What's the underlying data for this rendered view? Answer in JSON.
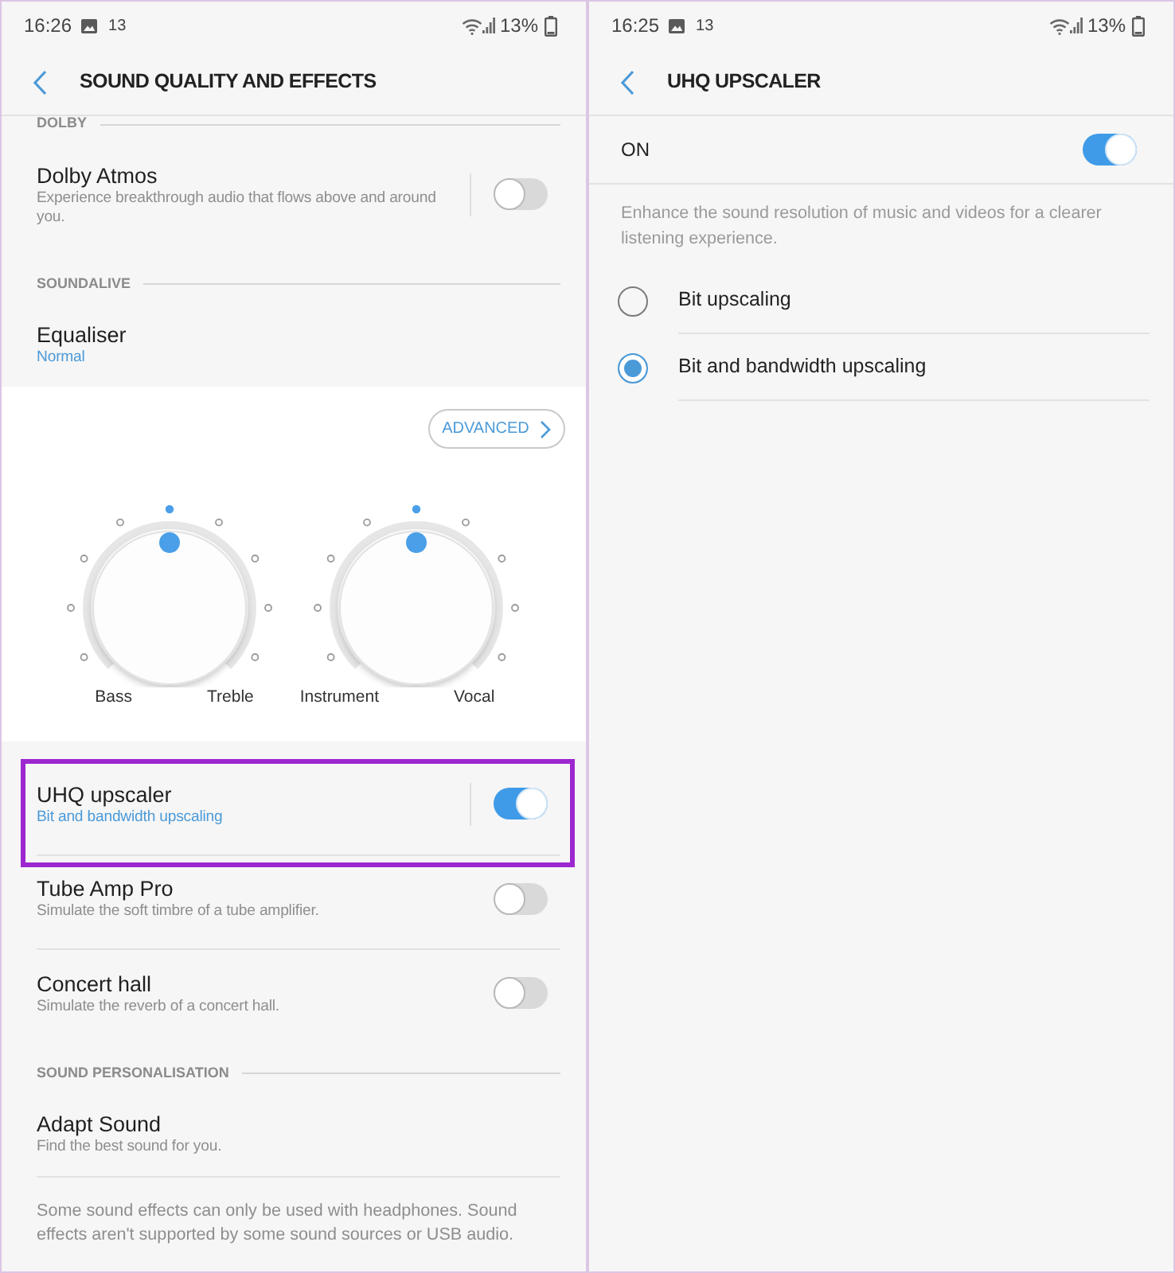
{
  "left_screen": {
    "status_bar": {
      "time": "16:26",
      "notification_count": "13",
      "battery_percent": "13%"
    },
    "header": {
      "title": "SOUND QUALITY AND EFFECTS"
    },
    "items": [
      {
        "kind": "section",
        "title": "DOLBY"
      },
      {
        "kind": "switch",
        "title": "Dolby Atmos",
        "subtitle": "Experience breakthrough audio that flows above and around you.",
        "accent": false,
        "split": true,
        "on": false,
        "highlighted": false
      },
      {
        "kind": "section",
        "title": "SOUNDALIVE"
      },
      {
        "kind": "link",
        "title": "Equaliser",
        "subtitle": "Normal",
        "accent": true
      },
      {
        "kind": "equaliser",
        "button": "ADVANCED",
        "knobs": [
          {
            "left_label": "Bass",
            "right_label": "Treble",
            "level": 0.5
          },
          {
            "left_label": "Instrument",
            "right_label": "Vocal",
            "level": 0.5
          }
        ]
      },
      {
        "kind": "switch",
        "title": "UHQ upscaler",
        "subtitle": "Bit and bandwidth upscaling",
        "accent": true,
        "split": true,
        "on": true,
        "highlighted": true
      },
      {
        "kind": "switch",
        "title": "Tube Amp Pro",
        "subtitle": "Simulate the soft timbre of a tube amplifier.",
        "accent": false,
        "split": false,
        "on": false,
        "highlighted": false
      },
      {
        "kind": "switch",
        "title": "Concert hall",
        "subtitle": "Simulate the reverb of a concert hall.",
        "accent": false,
        "split": false,
        "on": false,
        "highlighted": false
      },
      {
        "kind": "section",
        "title": "SOUND PERSONALISATION"
      },
      {
        "kind": "link",
        "title": "Adapt Sound",
        "subtitle": "Find the best sound for you.",
        "accent": false
      },
      {
        "kind": "note",
        "text": "Some sound effects can only be used with headphones. Sound effects aren't supported by some sound sources or USB audio."
      }
    ]
  },
  "right_screen": {
    "status_bar": {
      "time": "16:25",
      "notification_count": "13",
      "battery_percent": "13%"
    },
    "header": {
      "title": "UHQ UPSCALER"
    },
    "master_switch": {
      "label": "ON",
      "on": true
    },
    "description": "Enhance the sound resolution of music and videos for a clearer listening experience.",
    "options": [
      {
        "label": "Bit upscaling",
        "selected": false
      },
      {
        "label": "Bit and bandwidth upscaling",
        "selected": true
      }
    ]
  }
}
